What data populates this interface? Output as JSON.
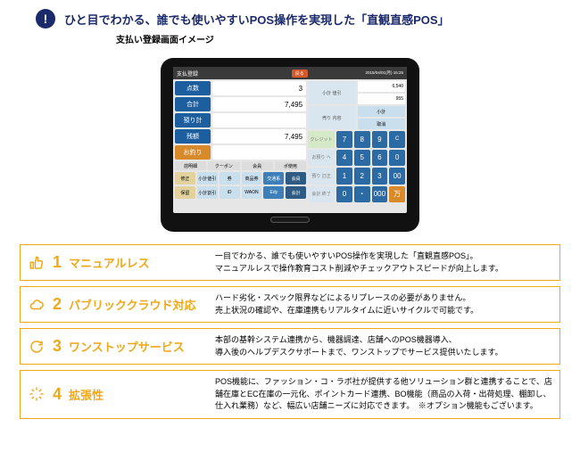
{
  "hero": {
    "title": "ひと目でわかる、誰でも使いやすいPOS操作を実現した「直観直感POS」",
    "subtitle": "支払い登録画面イメージ"
  },
  "pos": {
    "topbar_title": "支払登録",
    "back": "戻る",
    "datetime": "2015/04/01(月) 15:25",
    "mini_top": "6,540",
    "mini_bottom": "955",
    "rows": {
      "count_label": "点数",
      "count_value": "3",
      "total_label": "合計",
      "total_value": "7,495",
      "deposit_label": "預り計",
      "deposit_value": "",
      "balance_label": "残額",
      "balance_value": "7,495",
      "change_label": "お釣り",
      "change_value": ""
    },
    "smallrow": [
      "前明細",
      "クーポン",
      "会員",
      "ポ使用"
    ],
    "strip_r1": [
      "修正",
      "小計値引",
      "券",
      "商品券",
      "交通系",
      "会員"
    ],
    "strip_r2": [
      "保留",
      "小計割引",
      "iD",
      "WAON",
      "Edy",
      "会計"
    ],
    "r_cells": {
      "shoukei": "小計\n値引",
      "uriage": "売り\n内容",
      "credit": "クレジット",
      "oazukari": "お預り\nへ",
      "azukari": "預り\n訂正",
      "kaikei": "会計\n終了"
    },
    "sub_a": "小計",
    "sub_b": "取消"
  },
  "chart_data": {
    "type": "table",
    "title": "keypad",
    "rows": [
      [
        "7",
        "8",
        "9",
        "C"
      ],
      [
        "4",
        "5",
        "6",
        "0"
      ],
      [
        "1",
        "2",
        "3",
        "00"
      ],
      [
        "0",
        "・",
        "000",
        "万"
      ]
    ]
  },
  "features": [
    {
      "num": "1",
      "icon": "thumb",
      "title": "マニュアルレス",
      "desc": "一目でわかる、誰でも使いやすいPOS操作を実現した「直観直感POS」。\nマニュアルレスで操作教育コスト削減やチェックアウトスピードが向上します。"
    },
    {
      "num": "2",
      "icon": "cloud",
      "title": "パブリッククラウド対応",
      "desc": "ハード劣化・スペック限界などによるリプレースの必要がありません。\n売上状況の確認や、在庫連携もリアルタイムに近いサイクルで可能です。"
    },
    {
      "num": "3",
      "icon": "cycle",
      "title": "ワンストップサービス",
      "desc": "本部の基幹システム連携から、機器調達、店舗へのPOS機器導入、\n導入後のヘルプデスクサポートまで、ワンストップでサービス提供いたします。"
    },
    {
      "num": "4",
      "icon": "expand",
      "title": "拡張性",
      "desc": "POS機能に、ファッション・コ・ラボ社が提供する他ソリューション群と連携することで、店舗在庫とEC在庫の一元化、ポイントカード連携、BO機能（商品の入荷・出荷処理、棚卸し、仕入れ業務）など、幅広い店舗ニーズに対応できます。　※オプション機能もございます。"
    }
  ]
}
